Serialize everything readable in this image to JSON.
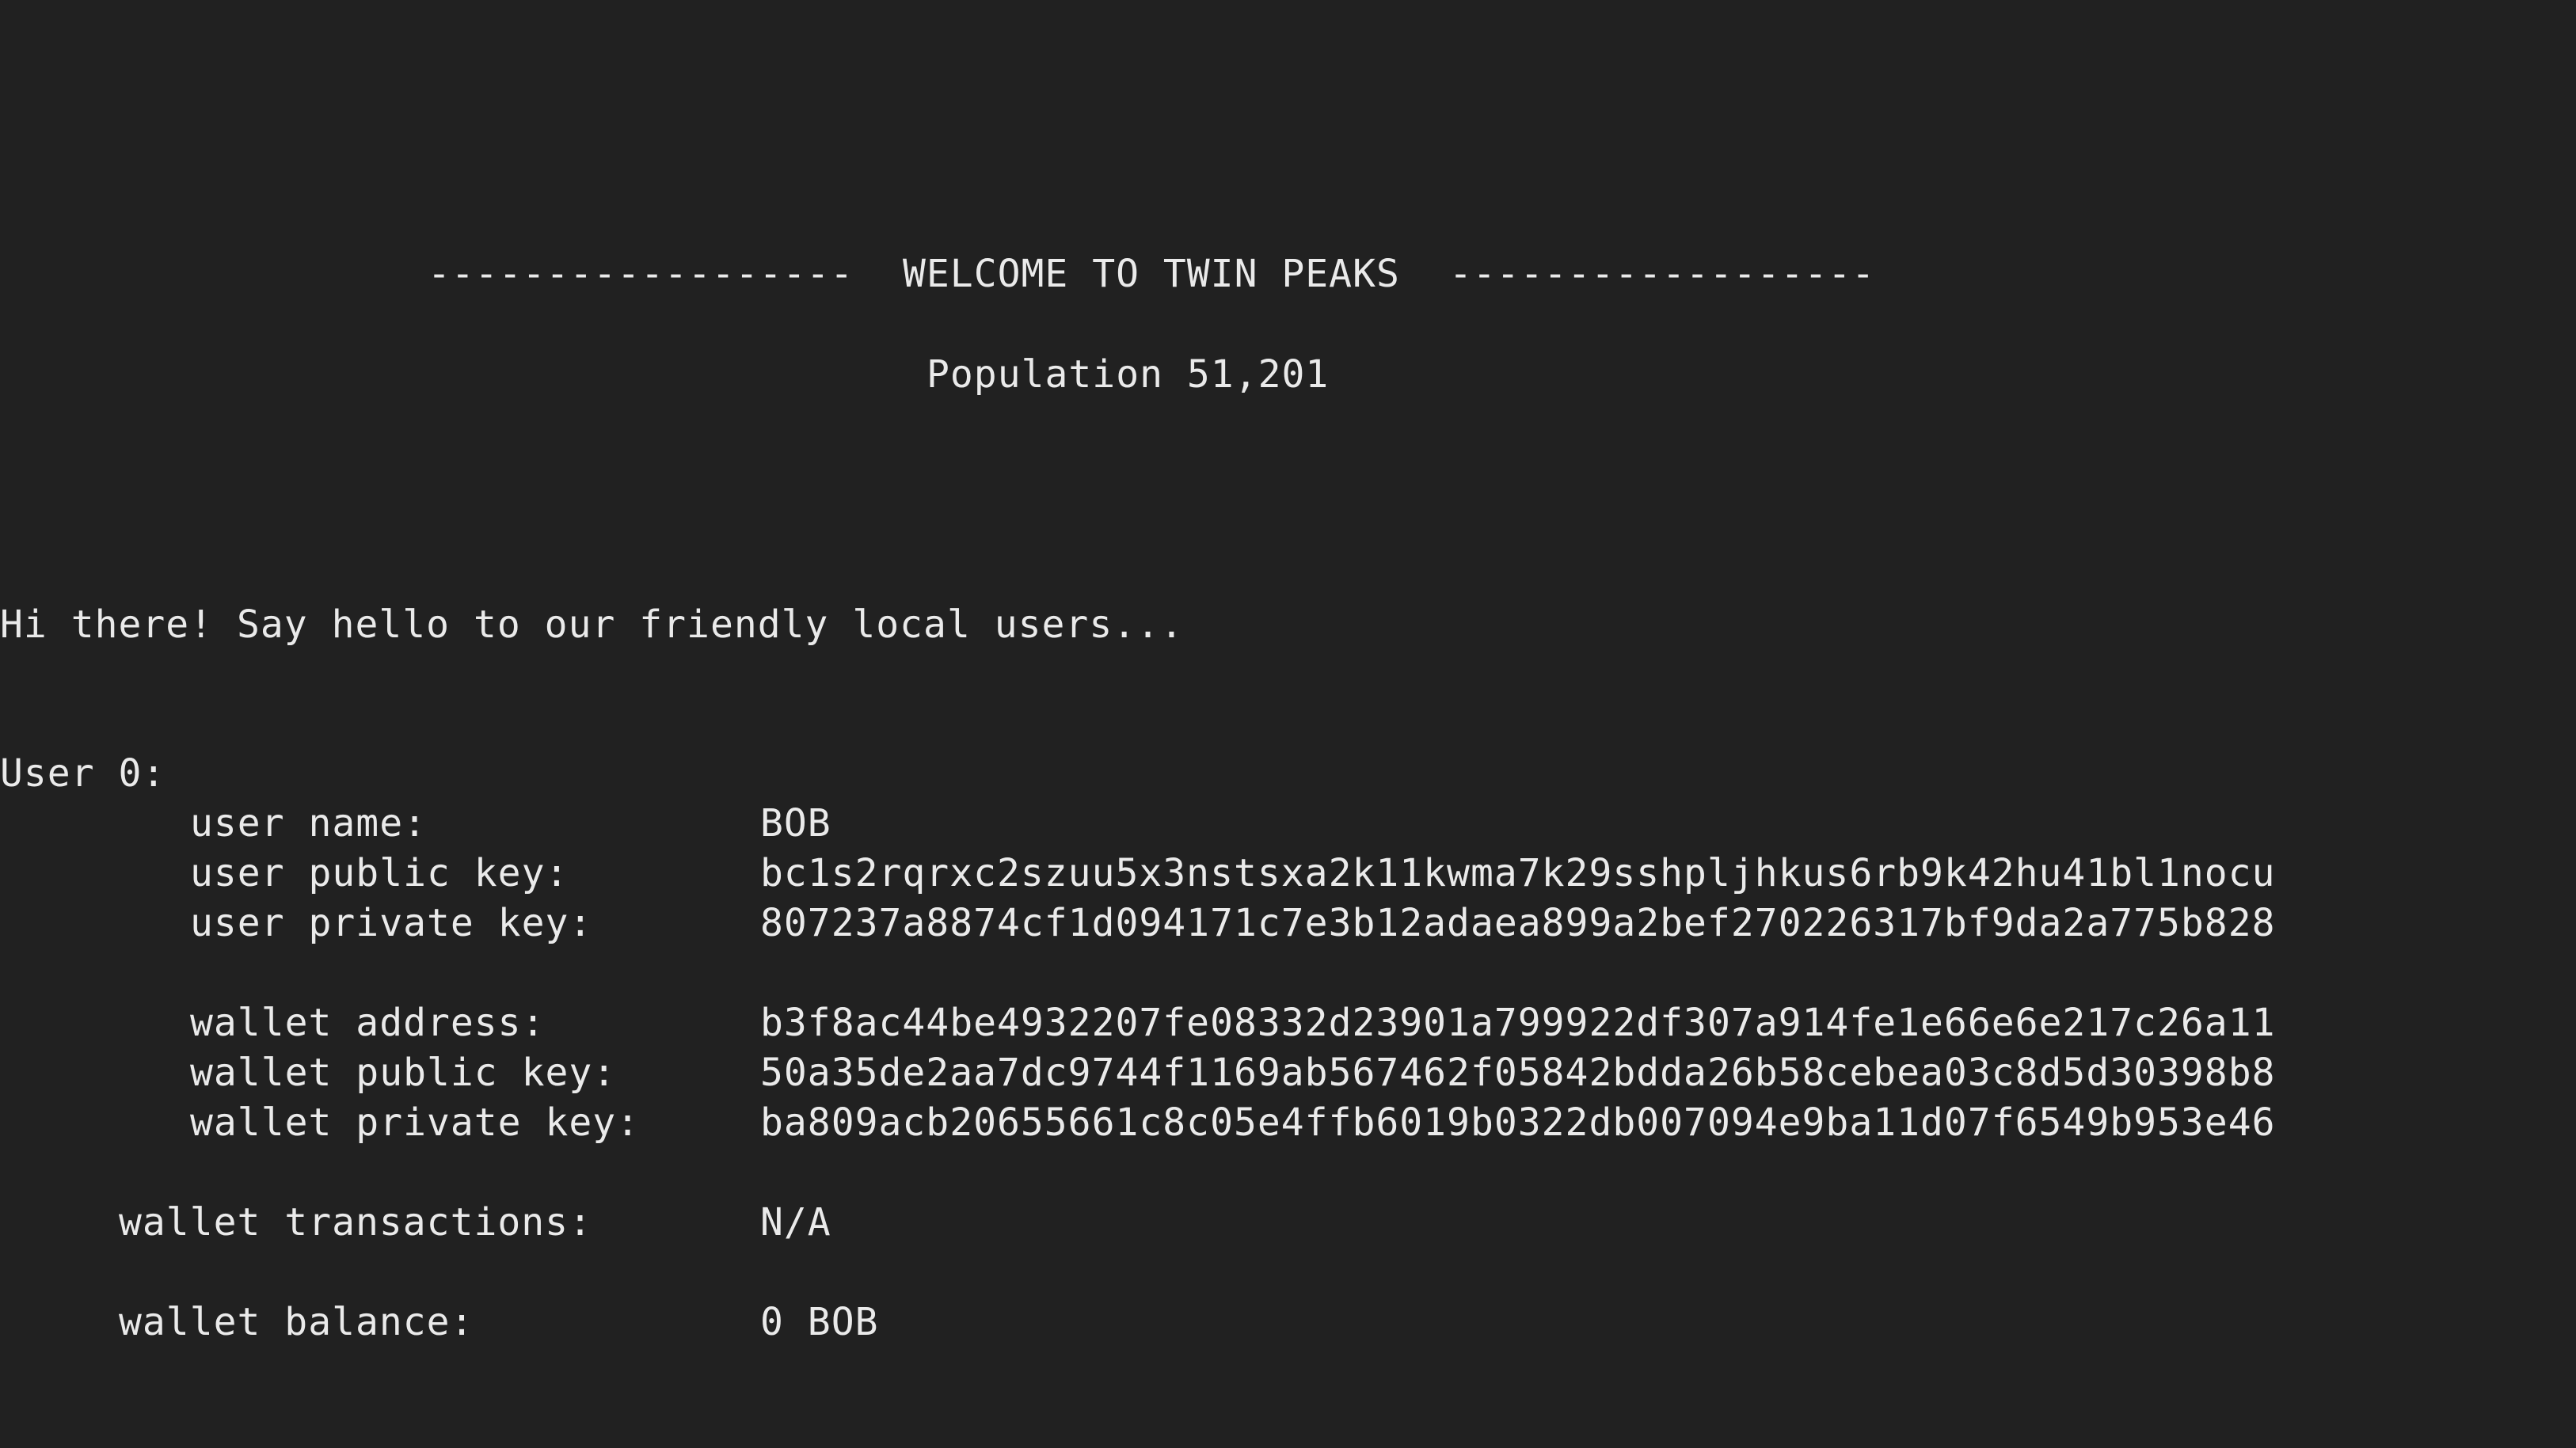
{
  "banner": {
    "left_rule": "------------------",
    "title": "WELCOME TO TWIN PEAKS",
    "right_rule": "------------------"
  },
  "population": "Population 51,201",
  "greeting": "Hi there! Say hello to our friendly local users...",
  "user": {
    "header": "User 0:",
    "fields": [
      {
        "label": "user name:",
        "value": "BOB"
      },
      {
        "label": "user public key:",
        "value": "bc1s2rqrxc2szuu5x3nstsxa2k11kwma7k29sshpljhkus6rb9k42hu41bl1nocu"
      },
      {
        "label": "user private key:",
        "value": "807237a8874cf1d094171c7e3b12adaea899a2bef270226317bf9da2a775b828"
      },
      {
        "label": "wallet address:",
        "value": "b3f8ac44be4932207fe08332d23901a799922df307a914fe1e66e6e217c26a11"
      },
      {
        "label": "wallet public key:",
        "value": "50a35de2aa7dc9744f1169ab567462f05842bdda26b58cebea03c8d5d30398b8"
      },
      {
        "label": "wallet private key:",
        "value": "ba809acb20655661c8c05e4ffb6019b0322db007094e9ba11d07f6549b953e46"
      }
    ],
    "transactions": {
      "label": "wallet transactions:",
      "value": "N/A"
    },
    "balance": {
      "label": "wallet balance:",
      "value": "0 BOB"
    }
  },
  "colors": {
    "background": "#212121",
    "text": "#eaeaea"
  }
}
